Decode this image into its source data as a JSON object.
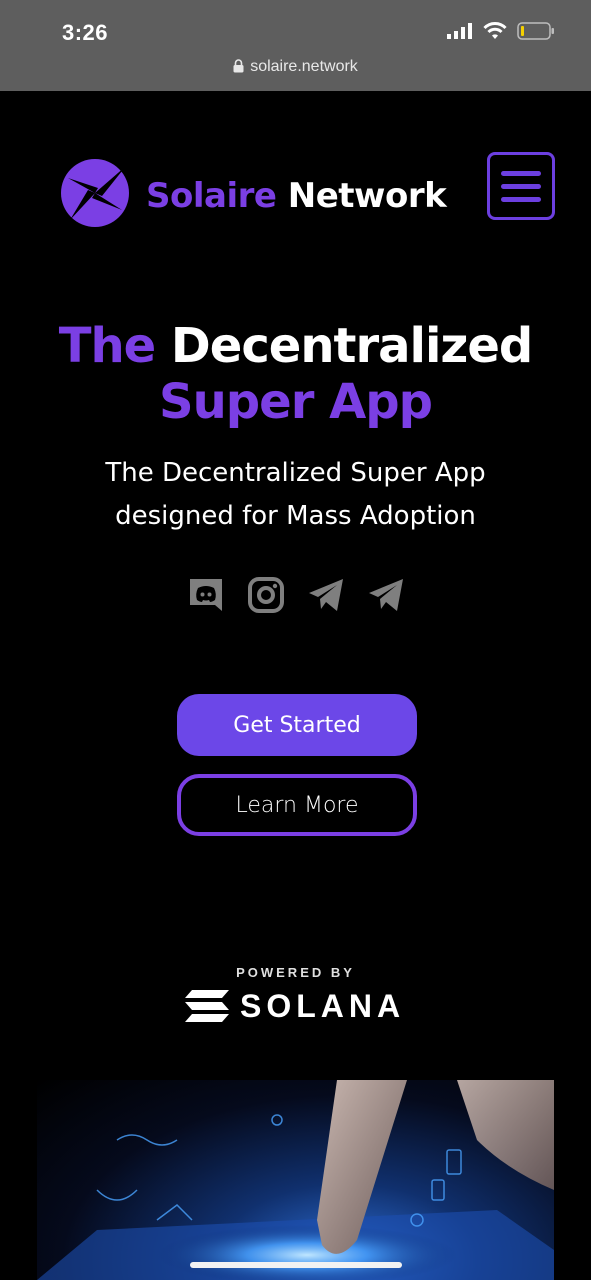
{
  "status_bar": {
    "time": "3:26"
  },
  "browser": {
    "url": "solaire.network"
  },
  "header": {
    "brand_part1": "Solaire",
    "brand_part2": "Network",
    "menu_icon": "hamburger-menu-icon"
  },
  "hero": {
    "title_part1": "The",
    "title_part2": "Decentralized",
    "title_part3": "Super App",
    "subtitle": "The Decentralized Super App designed for Mass Adoption"
  },
  "socials": [
    "discord-icon",
    "instagram-icon",
    "telegram-icon",
    "telegram-icon"
  ],
  "buttons": {
    "primary": "Get Started",
    "secondary": "Learn More"
  },
  "powered": {
    "label": "POWERED BY",
    "partner": "SOLANA"
  },
  "colors": {
    "accent": "#7b3fe4",
    "button": "#6c47e8",
    "background": "#000000",
    "status_bar": "#5e5e5e"
  }
}
